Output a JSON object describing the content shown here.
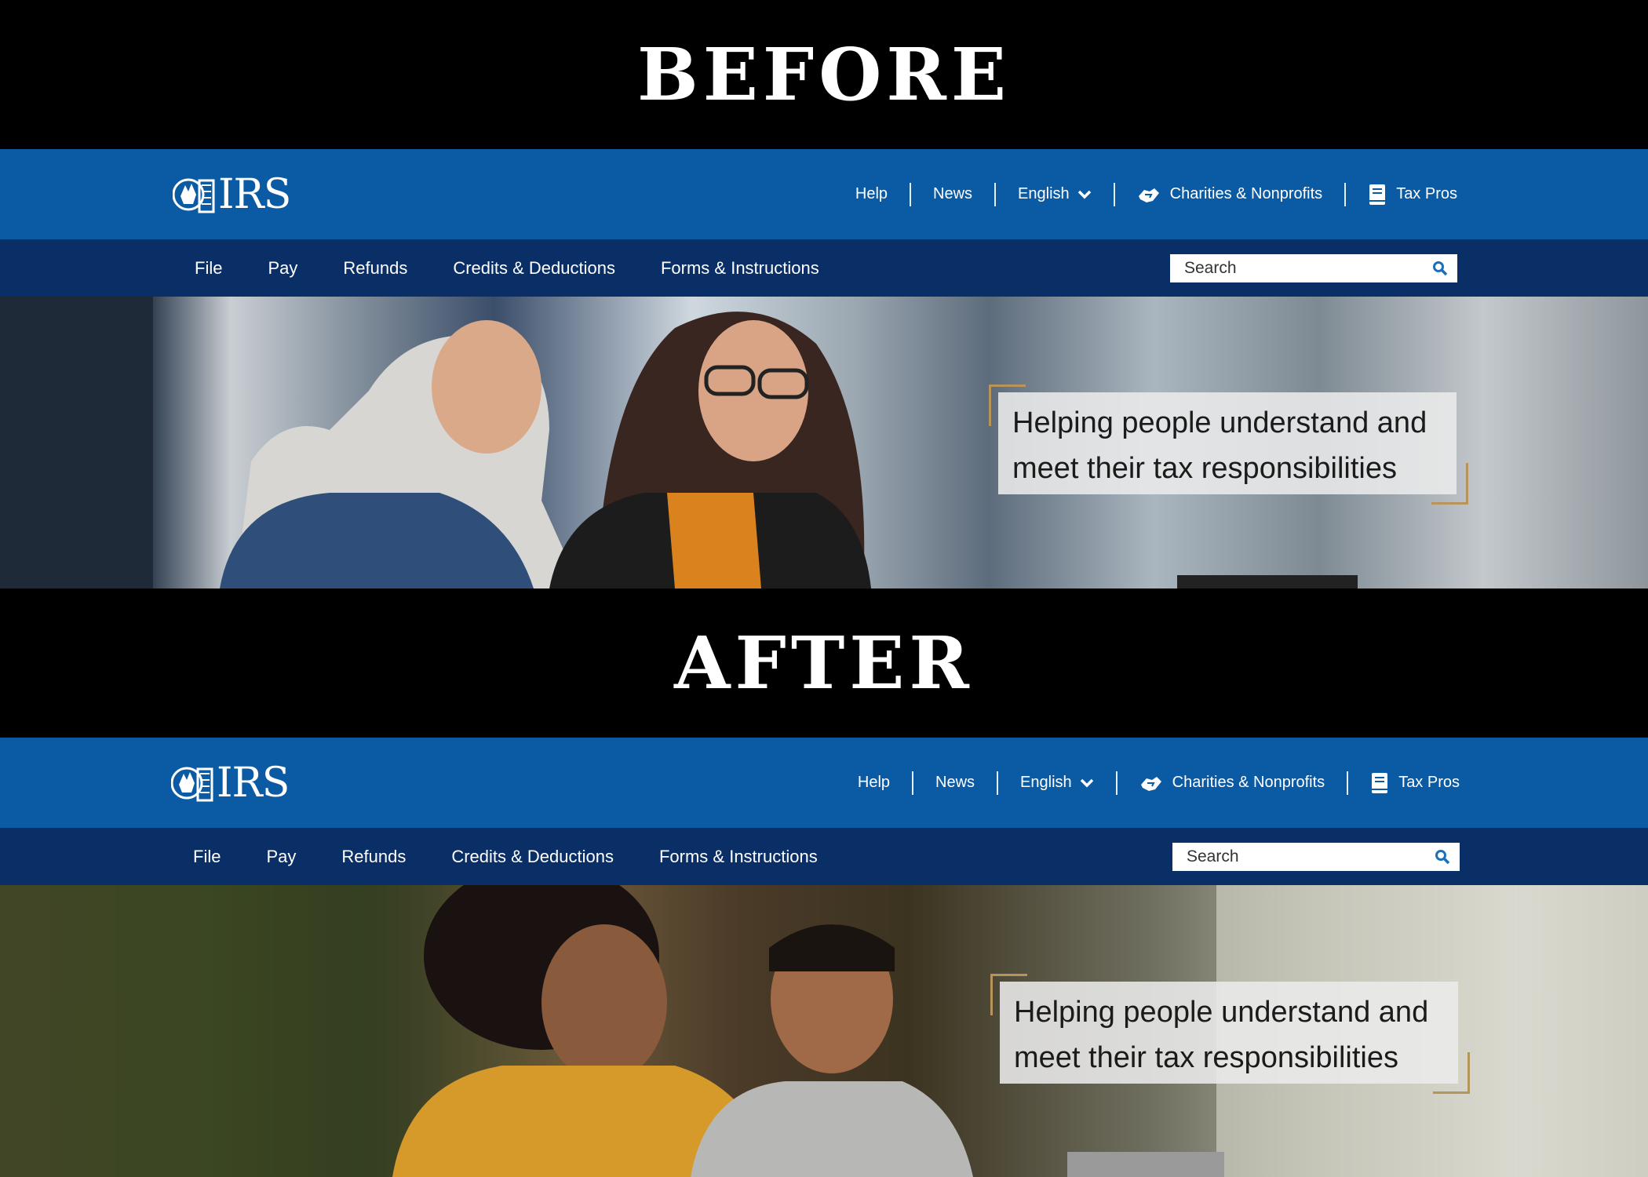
{
  "banners": {
    "before": "BEFORE",
    "after": "AFTER"
  },
  "site": {
    "logo_text": "IRS",
    "utility_nav": {
      "help": "Help",
      "news": "News",
      "language": "English",
      "charities": "Charities & Nonprofits",
      "taxpros": "Tax Pros"
    },
    "main_nav": [
      "File",
      "Pay",
      "Refunds",
      "Credits & Deductions",
      "Forms & Instructions"
    ],
    "search": {
      "placeholder": "Search"
    },
    "hero": {
      "line1": "Helping people understand and",
      "line2": "meet their tax responsibilities"
    },
    "colors": {
      "topbar": "#0b5aa4",
      "mainnav": "#0a2f66",
      "accent_corner": "#b8935a"
    }
  },
  "icons": [
    "irs-eagle-logo-icon",
    "chevron-down-icon",
    "handshake-icon",
    "book-icon",
    "search-icon"
  ]
}
